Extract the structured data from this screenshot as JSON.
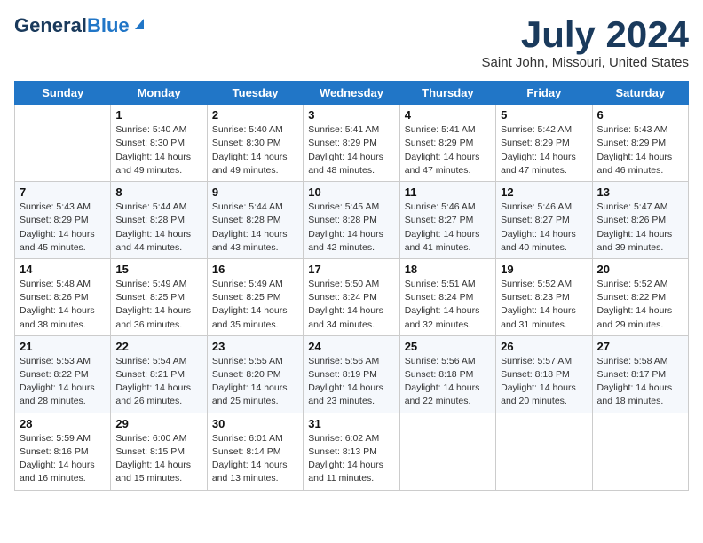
{
  "header": {
    "logo_general": "General",
    "logo_blue": "Blue",
    "month_year": "July 2024",
    "location": "Saint John, Missouri, United States"
  },
  "weekdays": [
    "Sunday",
    "Monday",
    "Tuesday",
    "Wednesday",
    "Thursday",
    "Friday",
    "Saturday"
  ],
  "weeks": [
    [
      {
        "day": "",
        "empty": true
      },
      {
        "day": "1",
        "sunrise": "Sunrise: 5:40 AM",
        "sunset": "Sunset: 8:30 PM",
        "daylight": "Daylight: 14 hours and 49 minutes."
      },
      {
        "day": "2",
        "sunrise": "Sunrise: 5:40 AM",
        "sunset": "Sunset: 8:30 PM",
        "daylight": "Daylight: 14 hours and 49 minutes."
      },
      {
        "day": "3",
        "sunrise": "Sunrise: 5:41 AM",
        "sunset": "Sunset: 8:29 PM",
        "daylight": "Daylight: 14 hours and 48 minutes."
      },
      {
        "day": "4",
        "sunrise": "Sunrise: 5:41 AM",
        "sunset": "Sunset: 8:29 PM",
        "daylight": "Daylight: 14 hours and 47 minutes."
      },
      {
        "day": "5",
        "sunrise": "Sunrise: 5:42 AM",
        "sunset": "Sunset: 8:29 PM",
        "daylight": "Daylight: 14 hours and 47 minutes."
      },
      {
        "day": "6",
        "sunrise": "Sunrise: 5:43 AM",
        "sunset": "Sunset: 8:29 PM",
        "daylight": "Daylight: 14 hours and 46 minutes."
      }
    ],
    [
      {
        "day": "7",
        "sunrise": "Sunrise: 5:43 AM",
        "sunset": "Sunset: 8:29 PM",
        "daylight": "Daylight: 14 hours and 45 minutes."
      },
      {
        "day": "8",
        "sunrise": "Sunrise: 5:44 AM",
        "sunset": "Sunset: 8:28 PM",
        "daylight": "Daylight: 14 hours and 44 minutes."
      },
      {
        "day": "9",
        "sunrise": "Sunrise: 5:44 AM",
        "sunset": "Sunset: 8:28 PM",
        "daylight": "Daylight: 14 hours and 43 minutes."
      },
      {
        "day": "10",
        "sunrise": "Sunrise: 5:45 AM",
        "sunset": "Sunset: 8:28 PM",
        "daylight": "Daylight: 14 hours and 42 minutes."
      },
      {
        "day": "11",
        "sunrise": "Sunrise: 5:46 AM",
        "sunset": "Sunset: 8:27 PM",
        "daylight": "Daylight: 14 hours and 41 minutes."
      },
      {
        "day": "12",
        "sunrise": "Sunrise: 5:46 AM",
        "sunset": "Sunset: 8:27 PM",
        "daylight": "Daylight: 14 hours and 40 minutes."
      },
      {
        "day": "13",
        "sunrise": "Sunrise: 5:47 AM",
        "sunset": "Sunset: 8:26 PM",
        "daylight": "Daylight: 14 hours and 39 minutes."
      }
    ],
    [
      {
        "day": "14",
        "sunrise": "Sunrise: 5:48 AM",
        "sunset": "Sunset: 8:26 PM",
        "daylight": "Daylight: 14 hours and 38 minutes."
      },
      {
        "day": "15",
        "sunrise": "Sunrise: 5:49 AM",
        "sunset": "Sunset: 8:25 PM",
        "daylight": "Daylight: 14 hours and 36 minutes."
      },
      {
        "day": "16",
        "sunrise": "Sunrise: 5:49 AM",
        "sunset": "Sunset: 8:25 PM",
        "daylight": "Daylight: 14 hours and 35 minutes."
      },
      {
        "day": "17",
        "sunrise": "Sunrise: 5:50 AM",
        "sunset": "Sunset: 8:24 PM",
        "daylight": "Daylight: 14 hours and 34 minutes."
      },
      {
        "day": "18",
        "sunrise": "Sunrise: 5:51 AM",
        "sunset": "Sunset: 8:24 PM",
        "daylight": "Daylight: 14 hours and 32 minutes."
      },
      {
        "day": "19",
        "sunrise": "Sunrise: 5:52 AM",
        "sunset": "Sunset: 8:23 PM",
        "daylight": "Daylight: 14 hours and 31 minutes."
      },
      {
        "day": "20",
        "sunrise": "Sunrise: 5:52 AM",
        "sunset": "Sunset: 8:22 PM",
        "daylight": "Daylight: 14 hours and 29 minutes."
      }
    ],
    [
      {
        "day": "21",
        "sunrise": "Sunrise: 5:53 AM",
        "sunset": "Sunset: 8:22 PM",
        "daylight": "Daylight: 14 hours and 28 minutes."
      },
      {
        "day": "22",
        "sunrise": "Sunrise: 5:54 AM",
        "sunset": "Sunset: 8:21 PM",
        "daylight": "Daylight: 14 hours and 26 minutes."
      },
      {
        "day": "23",
        "sunrise": "Sunrise: 5:55 AM",
        "sunset": "Sunset: 8:20 PM",
        "daylight": "Daylight: 14 hours and 25 minutes."
      },
      {
        "day": "24",
        "sunrise": "Sunrise: 5:56 AM",
        "sunset": "Sunset: 8:19 PM",
        "daylight": "Daylight: 14 hours and 23 minutes."
      },
      {
        "day": "25",
        "sunrise": "Sunrise: 5:56 AM",
        "sunset": "Sunset: 8:18 PM",
        "daylight": "Daylight: 14 hours and 22 minutes."
      },
      {
        "day": "26",
        "sunrise": "Sunrise: 5:57 AM",
        "sunset": "Sunset: 8:18 PM",
        "daylight": "Daylight: 14 hours and 20 minutes."
      },
      {
        "day": "27",
        "sunrise": "Sunrise: 5:58 AM",
        "sunset": "Sunset: 8:17 PM",
        "daylight": "Daylight: 14 hours and 18 minutes."
      }
    ],
    [
      {
        "day": "28",
        "sunrise": "Sunrise: 5:59 AM",
        "sunset": "Sunset: 8:16 PM",
        "daylight": "Daylight: 14 hours and 16 minutes."
      },
      {
        "day": "29",
        "sunrise": "Sunrise: 6:00 AM",
        "sunset": "Sunset: 8:15 PM",
        "daylight": "Daylight: 14 hours and 15 minutes."
      },
      {
        "day": "30",
        "sunrise": "Sunrise: 6:01 AM",
        "sunset": "Sunset: 8:14 PM",
        "daylight": "Daylight: 14 hours and 13 minutes."
      },
      {
        "day": "31",
        "sunrise": "Sunrise: 6:02 AM",
        "sunset": "Sunset: 8:13 PM",
        "daylight": "Daylight: 14 hours and 11 minutes."
      },
      {
        "day": "",
        "empty": true
      },
      {
        "day": "",
        "empty": true
      },
      {
        "day": "",
        "empty": true
      }
    ]
  ]
}
